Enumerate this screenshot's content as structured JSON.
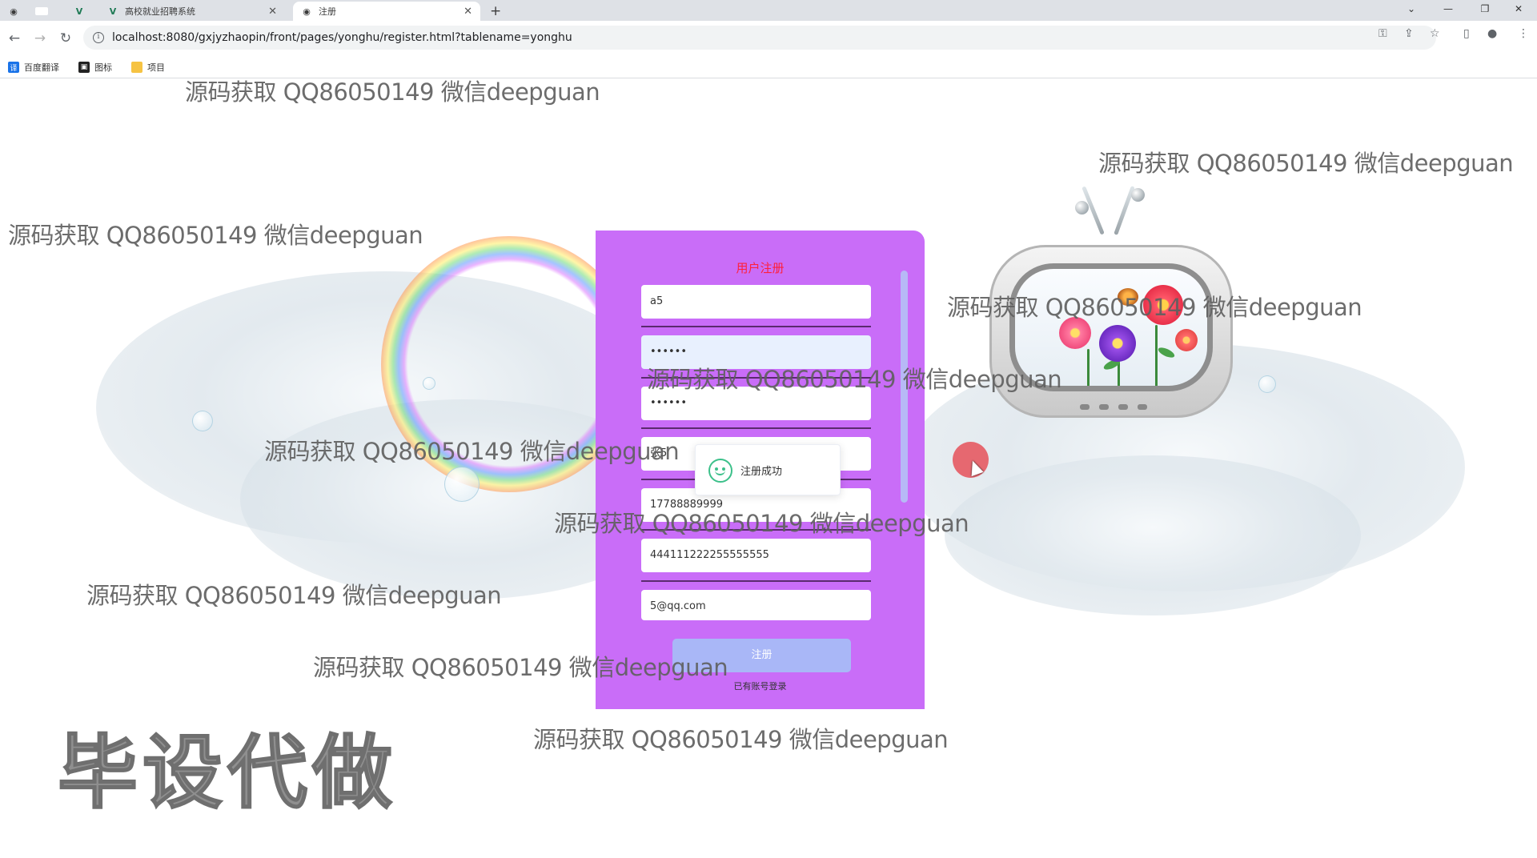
{
  "browser": {
    "tabs": [
      {
        "label": ""
      },
      {
        "label": ""
      },
      {
        "label": ""
      },
      {
        "label": "高校就业招聘系统"
      },
      {
        "label": "注册"
      }
    ],
    "url": "localhost:8080/gxjyzhaopin/front/pages/yonghu/register.html?tablename=yonghu",
    "bookmarks": [
      {
        "label": "百度翻译",
        "color": "#1a73e8"
      },
      {
        "label": "图标",
        "color": "#222222"
      },
      {
        "label": "项目",
        "color": "#f6c343"
      }
    ]
  },
  "form": {
    "title": "用户注册",
    "title_color": "#ff1f3a",
    "panel_color": "#c96df8",
    "fields": [
      {
        "value": "a5"
      },
      {
        "value": "••••••"
      },
      {
        "value": "••••••"
      },
      {
        "value": "张5"
      },
      {
        "value": "17788889999"
      },
      {
        "value": "444111222255555555"
      },
      {
        "value": "5@qq.com"
      }
    ],
    "submit_label": "注册",
    "login_link": "已有账号登录"
  },
  "toast": {
    "message": "注册成功",
    "accent": "#3cc08a"
  },
  "watermark": {
    "text": "源码获取 QQ86050149 微信deepguan",
    "big_text": "毕设代做"
  }
}
